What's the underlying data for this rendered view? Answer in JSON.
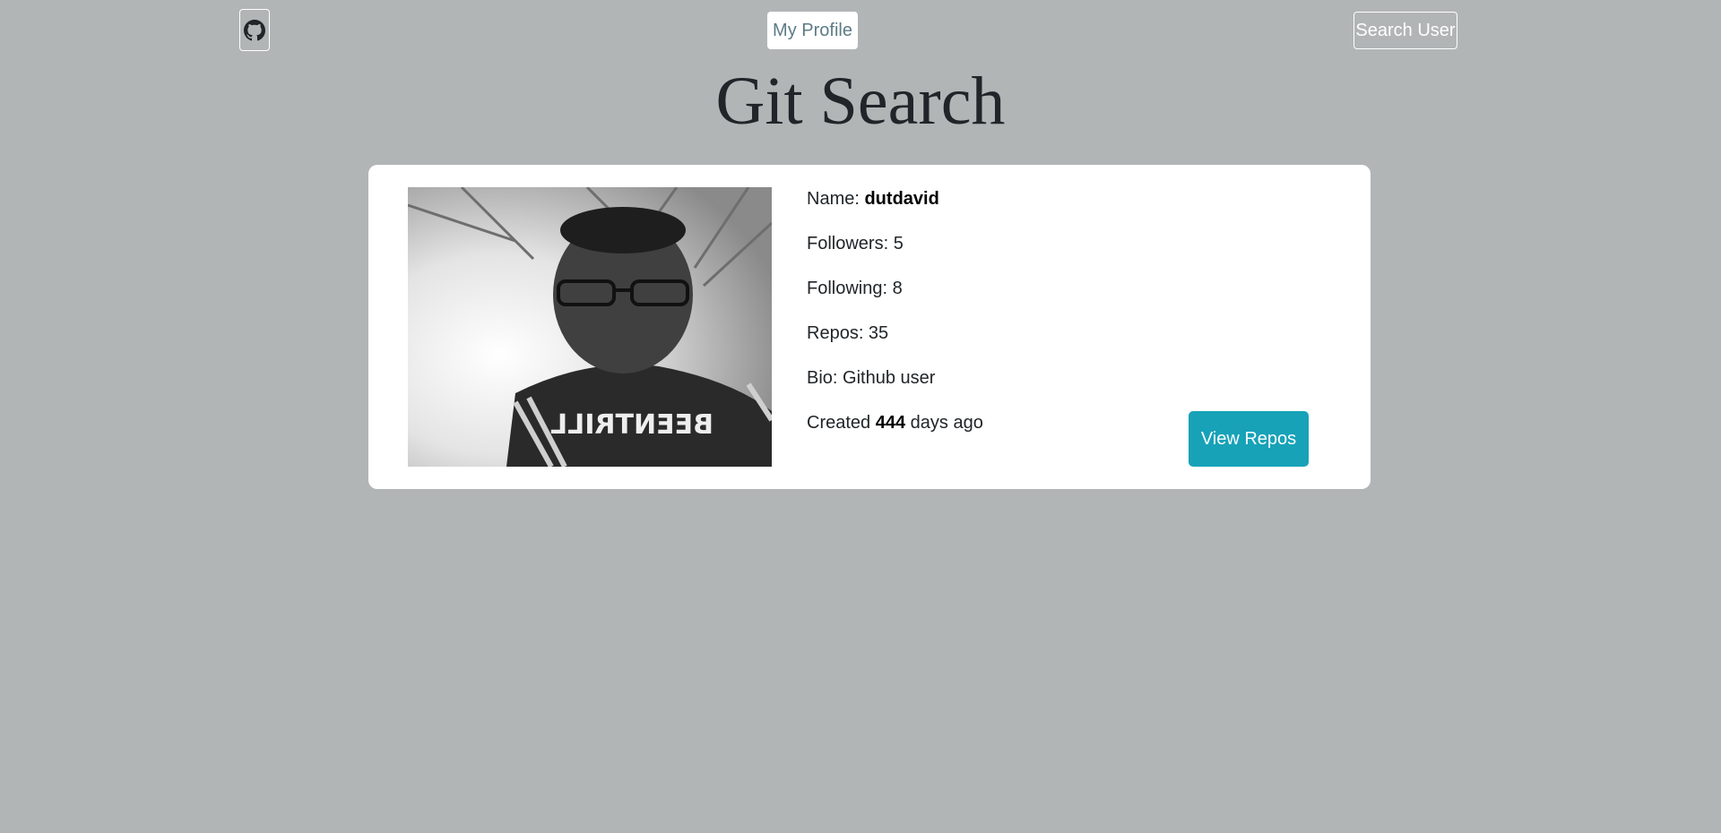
{
  "nav": {
    "github_icon": "github-icon",
    "my_profile_label": "My Profile",
    "search_user_label": "Search User"
  },
  "page": {
    "title": "Git Search"
  },
  "profile": {
    "name_label": "Name: ",
    "name_value": "dutdavid",
    "followers_text": "Followers: 5",
    "following_text": "Following: 8",
    "repos_text": "Repos: 35",
    "bio_text": "Bio: Github user",
    "created_prefix": "Created ",
    "created_days": "444",
    "created_suffix": " days ago",
    "view_repos_label": "View Repos",
    "avatar_shirt_text": "BEENTRILL"
  },
  "colors": {
    "background": "#b1b5b6",
    "accent": "#17a2b8",
    "profile_link": "#5d7b87"
  }
}
